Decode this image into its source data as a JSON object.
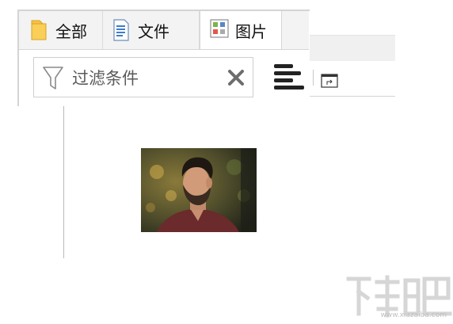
{
  "tabs": [
    {
      "label": "全部",
      "icon": "folder-icon",
      "active": false
    },
    {
      "label": "文件",
      "icon": "document-icon",
      "active": false
    },
    {
      "label": "图片",
      "icon": "image-grid-icon",
      "active": true
    }
  ],
  "filter": {
    "placeholder": "过滤条件",
    "icon": "filter-icon",
    "clear_icon": "close-icon"
  },
  "toolbar": {
    "align_icon": "align-left-icon",
    "popout_icon": "open-external-icon"
  },
  "results": {
    "thumbnail_description": "photo-thumbnail"
  },
  "watermark": {
    "logo_text": "下载吧",
    "url": "www.xiazaiba.com"
  },
  "colors": {
    "folder_yellow": "#f6c343",
    "doc_blue": "#3d7dc9",
    "border_gray": "#d4d4d4"
  }
}
